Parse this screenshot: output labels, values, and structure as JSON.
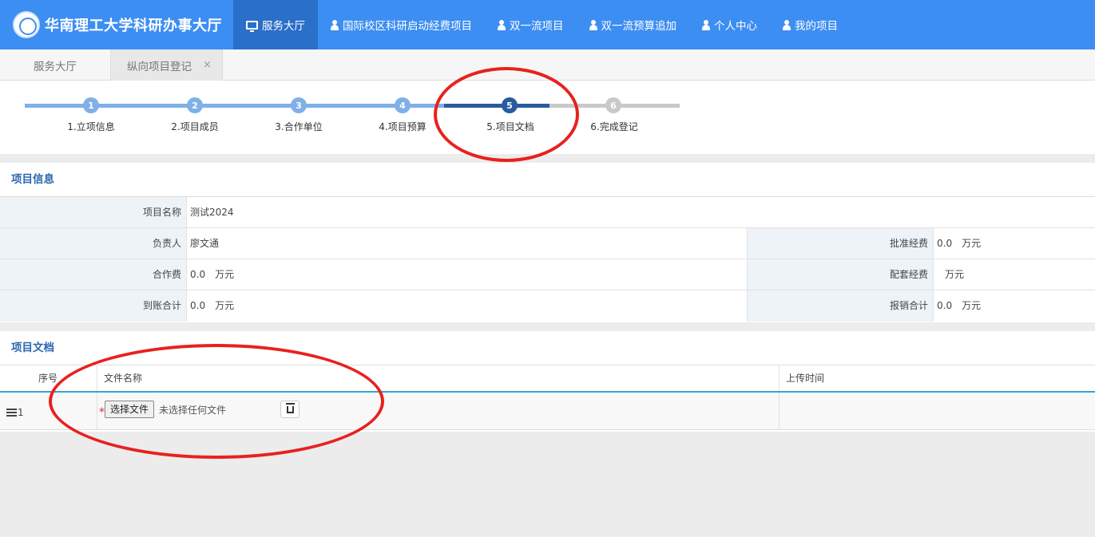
{
  "header": {
    "title": "华南理工大学科研办事大厅",
    "nav": [
      {
        "label": "服务大厅",
        "icon": "monitor-icon",
        "active": true
      },
      {
        "label": "国际校区科研启动经费项目",
        "icon": "user-icon"
      },
      {
        "label": "双一流项目",
        "icon": "user-icon"
      },
      {
        "label": "双一流预算追加",
        "icon": "user-icon"
      },
      {
        "label": "个人中心",
        "icon": "user-icon"
      },
      {
        "label": "我的项目",
        "icon": "user-icon"
      }
    ]
  },
  "tabs": [
    {
      "label": "服务大厅"
    },
    {
      "label": "纵向项目登记",
      "close": "×"
    }
  ],
  "steps": [
    {
      "num": "1",
      "label": "1.立项信息",
      "state": "done"
    },
    {
      "num": "2",
      "label": "2.项目成员",
      "state": "done"
    },
    {
      "num": "3",
      "label": "3.合作单位",
      "state": "done"
    },
    {
      "num": "4",
      "label": "4.项目预算",
      "state": "done"
    },
    {
      "num": "5",
      "label": "5.项目文档",
      "state": "current"
    },
    {
      "num": "6",
      "label": "6.完成登记",
      "state": "todo"
    }
  ],
  "project_info": {
    "title": "项目信息",
    "name_label": "项目名称",
    "name_value": "测试2024",
    "leader_label": "负责人",
    "leader_value": "廖文通",
    "approved_label": "批准经费",
    "approved_value": "0.0",
    "coop_label": "合作费",
    "coop_value": "0.0",
    "matching_label": "配套经费",
    "matching_value": "",
    "received_label": "到账合计",
    "received_value": "0.0",
    "reimb_label": "报销合计",
    "reimb_value": "0.0",
    "unit": "万元"
  },
  "project_docs": {
    "title": "项目文档",
    "columns": [
      "序号",
      "文件名称",
      "上传时间"
    ],
    "rows": [
      {
        "index": "1",
        "required_mark": "*",
        "choose_label": "选择文件",
        "file_status": "未选择任何文件",
        "upload_time": ""
      }
    ]
  },
  "colors": {
    "brand": "#3d8ef2",
    "nav_active": "#2a6fc9",
    "step_done": "#7fb0e8",
    "step_current": "#2a5b9f",
    "step_todo": "#c9c9c9",
    "annotation": "#e8211d"
  }
}
